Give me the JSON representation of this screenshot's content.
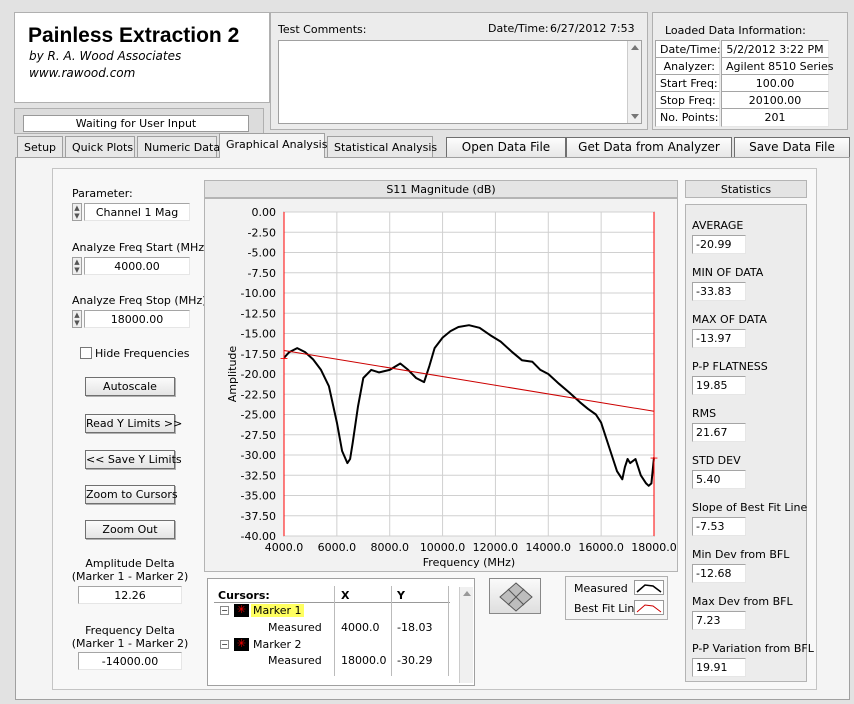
{
  "app": {
    "title": "Painless Extraction 2",
    "company": "by R. A. Wood Associates",
    "website": "www.rawood.com"
  },
  "status": "Waiting for User Input",
  "test_comments": {
    "label": "Test Comments:",
    "value": ""
  },
  "datetime": {
    "label": "Date/Time:",
    "value": "6/27/2012  7:53"
  },
  "loaded_info": {
    "title": "Loaded Data Information:",
    "rows": [
      {
        "label": "Date/Time:",
        "value": "5/2/2012 3:22 PM"
      },
      {
        "label": "Analyzer:",
        "value": "Agilent 8510 Series"
      },
      {
        "label": "Start Freq:",
        "value": "100.00"
      },
      {
        "label": "Stop Freq:",
        "value": "20100.00"
      },
      {
        "label": "No. Points:",
        "value": "201"
      }
    ]
  },
  "tabs": [
    "Setup",
    "Quick Plots",
    "Numeric Data",
    "Graphical Analysis",
    "Statistical Analysis"
  ],
  "actions": {
    "open": "Open Data File",
    "get": "Get Data from Analyzer",
    "save": "Save Data File"
  },
  "left": {
    "parameter_label": "Parameter:",
    "parameter_value": "Channel 1 Mag",
    "start_label": "Analyze Freq Start (MHz)",
    "start_value": "4000.00",
    "stop_label": "Analyze Freq Stop (MHz)",
    "stop_value": "18000.00",
    "hide_freq": "Hide Frequencies",
    "autoscale": "Autoscale",
    "read_y": "Read Y Limits >>",
    "save_y": "<< Save Y Limits",
    "zoom_cursors": "Zoom to Cursors",
    "zoom_out": "Zoom Out",
    "amp_delta_label1": "Amplitude Delta",
    "amp_delta_label2": "(Marker 1 - Marker 2)",
    "amp_delta_value": "12.26",
    "freq_delta_label1": "Frequency Delta",
    "freq_delta_label2": "(Marker 1 - Marker 2)",
    "freq_delta_value": "-14000.00"
  },
  "cursors": {
    "header": [
      "Cursors:",
      "X",
      "Y"
    ],
    "rows": [
      {
        "name": "Marker 1",
        "sub": "Measured",
        "x": "4000.0",
        "y": "-18.03"
      },
      {
        "name": "Marker 2",
        "sub": "Measured",
        "x": "18000.0",
        "y": "-30.29"
      }
    ]
  },
  "legend": {
    "measured": "Measured",
    "bfl": "Best Fit Line"
  },
  "stats": {
    "title": "Statistics",
    "items": [
      {
        "label": "AVERAGE",
        "value": "-20.99"
      },
      {
        "label": "MIN OF DATA",
        "value": "-33.83"
      },
      {
        "label": "MAX OF DATA",
        "value": "-13.97"
      },
      {
        "label": "P-P FLATNESS",
        "value": "19.85"
      },
      {
        "label": "RMS",
        "value": "21.67"
      },
      {
        "label": "STD DEV",
        "value": "5.40"
      },
      {
        "label": "Slope of Best Fit Line",
        "value": "-7.53"
      },
      {
        "label": "Min Dev from BFL",
        "value": "-12.68"
      },
      {
        "label": "Max Dev from BFL",
        "value": "7.23"
      },
      {
        "label": "P-P Variation from BFL",
        "value": "19.91"
      }
    ]
  },
  "colors": {
    "measured": "#000000",
    "bestfit": "#cc0000",
    "marker": "#ff0000",
    "highlight": "#ffff60"
  },
  "chart_data": {
    "type": "line",
    "title": "S11 Magnitude (dB)",
    "xlabel": "Frequency (MHz)",
    "ylabel": "Amplitude",
    "xlim": [
      4000,
      18000
    ],
    "ylim": [
      -40,
      0
    ],
    "xticks": [
      4000,
      6000,
      8000,
      10000,
      12000,
      14000,
      16000,
      18000
    ],
    "yticks": [
      0,
      -2.5,
      -5,
      -7.5,
      -10,
      -12.5,
      -15,
      -17.5,
      -20,
      -22.5,
      -25,
      -27.5,
      -30,
      -32.5,
      -35,
      -37.5,
      -40
    ],
    "grid": true,
    "series": [
      {
        "name": "Measured",
        "x": [
          4000,
          4200,
          4500,
          4800,
          5100,
          5400,
          5700,
          6000,
          6200,
          6400,
          6500,
          6600,
          6800,
          7000,
          7300,
          7600,
          8000,
          8400,
          8700,
          9000,
          9300,
          9500,
          9700,
          10000,
          10300,
          10600,
          11000,
          11400,
          11800,
          12200,
          12600,
          13000,
          13400,
          13700,
          14000,
          14400,
          14800,
          15200,
          15500,
          15800,
          16000,
          16200,
          16400,
          16600,
          16800,
          16900,
          17000,
          17100,
          17300,
          17500,
          17700,
          17800,
          17900,
          18000
        ],
        "y": [
          -18.0,
          -17.3,
          -16.8,
          -17.3,
          -18.2,
          -19.5,
          -21.5,
          -26.0,
          -29.5,
          -31.0,
          -30.5,
          -28.5,
          -24.0,
          -20.5,
          -19.5,
          -19.8,
          -19.5,
          -18.7,
          -19.5,
          -20.5,
          -21.0,
          -19.0,
          -16.8,
          -15.5,
          -14.7,
          -14.2,
          -13.97,
          -14.3,
          -15.2,
          -16.0,
          -17.2,
          -18.3,
          -18.5,
          -19.5,
          -20.0,
          -21.2,
          -22.3,
          -23.5,
          -24.3,
          -25.0,
          -26.0,
          -28.0,
          -30.0,
          -32.0,
          -33.0,
          -31.5,
          -30.5,
          -31.0,
          -30.5,
          -32.5,
          -33.5,
          -33.8,
          -33.5,
          -30.3
        ]
      },
      {
        "name": "Best Fit Line",
        "x": [
          4000,
          18000
        ],
        "y": [
          -17.1,
          -24.6
        ]
      }
    ],
    "markers": [
      {
        "name": "Marker 1",
        "x": 4000,
        "y": -18.03
      },
      {
        "name": "Marker 2",
        "x": 18000,
        "y": -30.29
      }
    ]
  }
}
